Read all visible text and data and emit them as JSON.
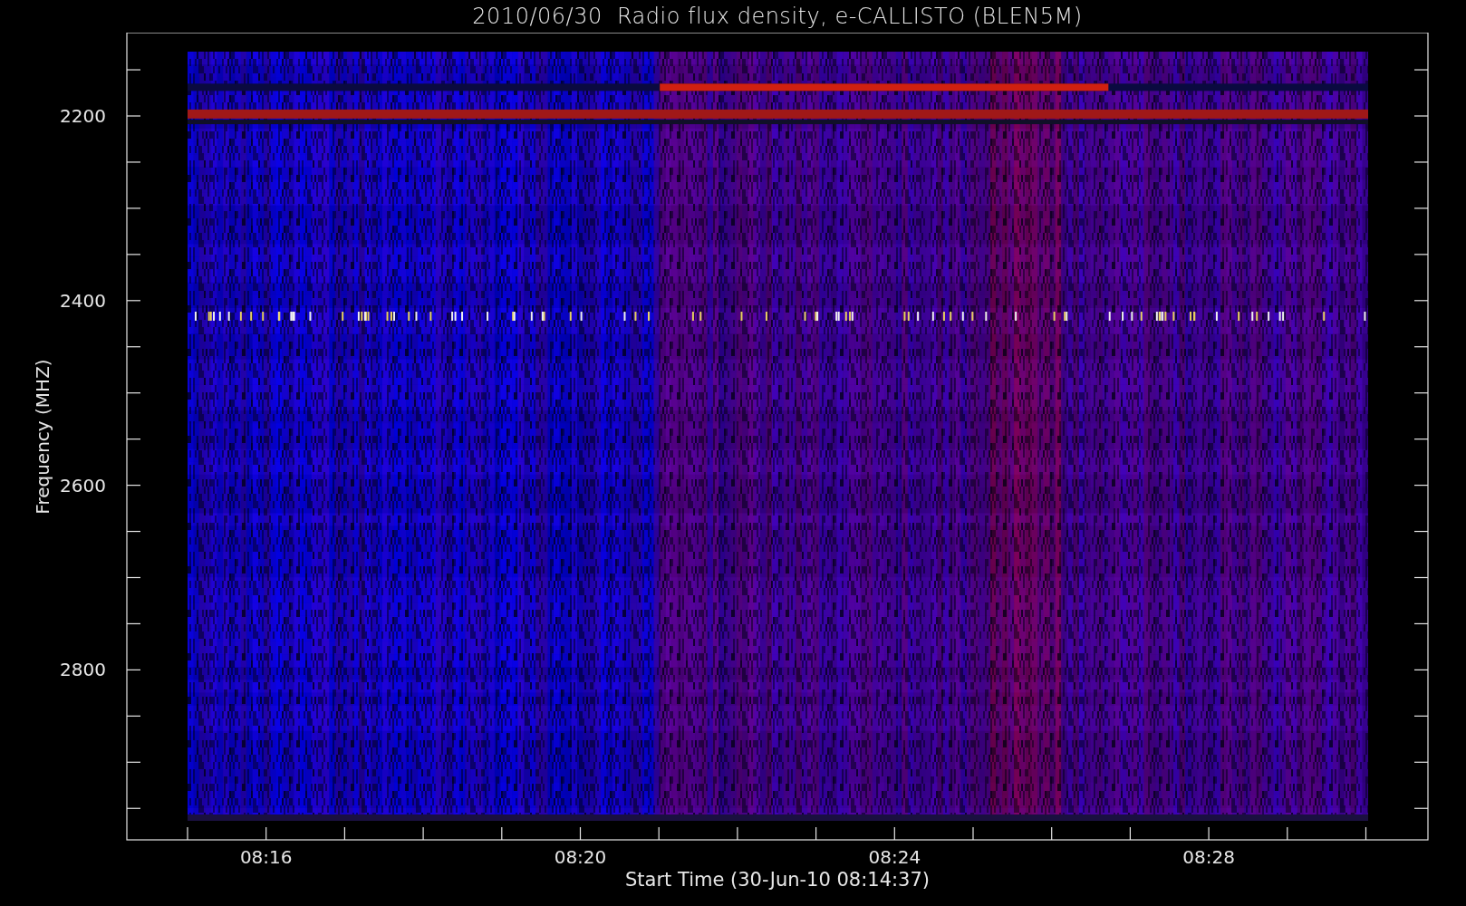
{
  "chart": {
    "title": "2010/06/30  Radio flux density, e-CALLISTO (BLEN5M)",
    "ylabel": "Frequency (MHZ)",
    "xlabel": "Start Time (30-Jun-10 08:14:37)",
    "yticks": [
      {
        "label": "2200"
      },
      {
        "label": "2400"
      },
      {
        "label": "2600"
      },
      {
        "label": "2800"
      }
    ],
    "xticks": [
      {
        "label": "08:16"
      },
      {
        "label": "08:20"
      },
      {
        "label": "08:24"
      },
      {
        "label": "08:28"
      }
    ]
  }
}
